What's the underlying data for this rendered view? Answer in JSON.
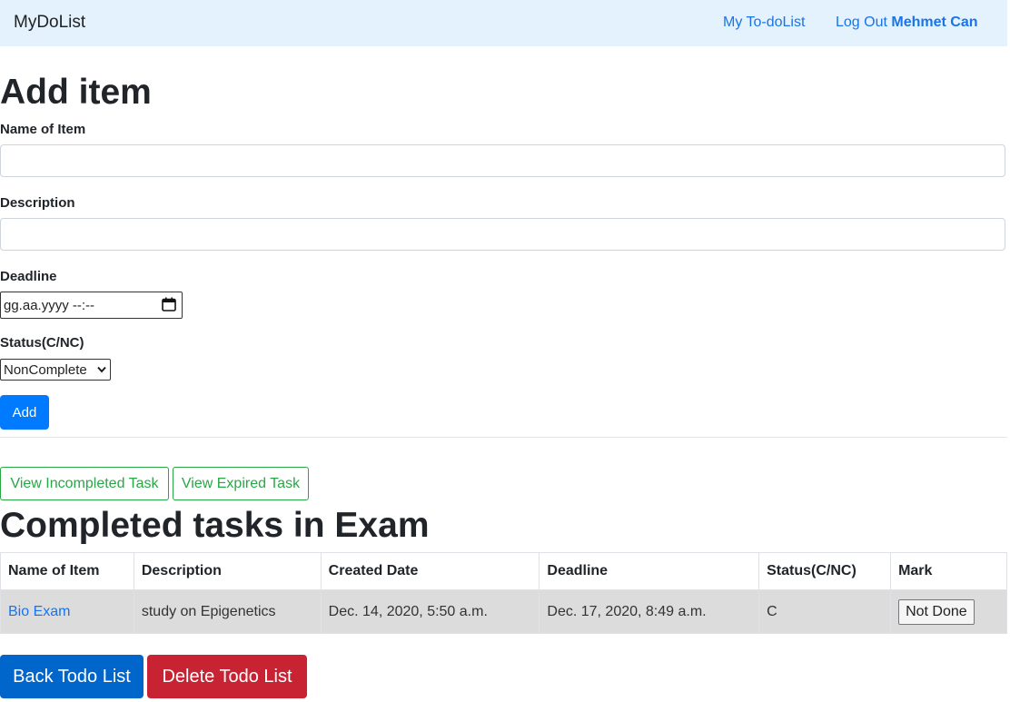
{
  "navbar": {
    "brand": "MyDoList",
    "my_todo_link": "My To-doList",
    "logout_label": "Log Out",
    "username": "Mehmet Can"
  },
  "add_form": {
    "title": "Add item",
    "name_label": "Name of Item",
    "name_value": "",
    "description_label": "Description",
    "description_value": "",
    "deadline_label": "Deadline",
    "deadline_placeholder": "gg.aa.yyyy --:--",
    "status_label": "Status(C/NC)",
    "status_selected": "NonComplete",
    "add_button": "Add"
  },
  "filters": {
    "incomplete_button": "View Incompleted Task",
    "expired_button": "View Expired Task"
  },
  "completed": {
    "title": "Completed tasks in Exam",
    "columns": [
      "Name of Item",
      "Description",
      "Created Date",
      "Deadline",
      "Status(C/NC)",
      "Mark"
    ],
    "rows": [
      {
        "name": "Bio Exam",
        "description": "study on Epigenetics",
        "created": "Dec. 14, 2020, 5:50 a.m.",
        "deadline": "Dec. 17, 2020, 8:49 a.m.",
        "status": "C",
        "mark_button": "Not Done"
      }
    ]
  },
  "footer_buttons": {
    "back": "Back Todo List",
    "delete": "Delete Todo List"
  },
  "colors": {
    "navbar_bg": "#e3f2fd",
    "primary": "#007bff",
    "success": "#28a745",
    "danger": "#c82333"
  }
}
